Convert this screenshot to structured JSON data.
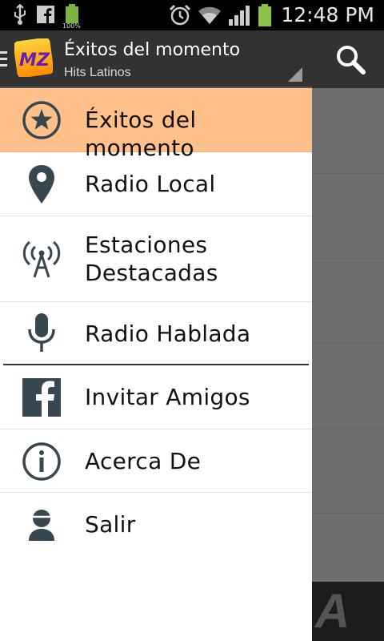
{
  "status_bar": {
    "time": "12:48 PM",
    "battery_small_label": "100%",
    "icons": [
      "usb-icon",
      "facebook-notification-icon",
      "battery-small-icon",
      "alarm-icon",
      "wifi-icon",
      "signal-icon",
      "battery-icon"
    ]
  },
  "action_bar": {
    "title": "Éxitos del momento",
    "subtitle": "Hits Latinos",
    "logo_text": "MZ",
    "search_icon": "search-icon"
  },
  "drawer": {
    "items": [
      {
        "label": "Éxitos del momento",
        "icon": "star-icon",
        "selected": true
      },
      {
        "label": "Radio Local",
        "icon": "location-pin-icon"
      },
      {
        "label": "Estaciones\nDestacadas",
        "icon": "antenna-icon"
      },
      {
        "label": "Radio Hablada",
        "icon": "microphone-icon"
      },
      {
        "label": "Invitar Amigos",
        "icon": "facebook-icon"
      },
      {
        "label": "Acerca De",
        "icon": "info-icon"
      },
      {
        "label": "Salir",
        "icon": "user-icon"
      }
    ]
  },
  "background_peek": {
    "text": "A"
  },
  "colors": {
    "selected_item_bg": "#ffc08a",
    "action_bar_bg": "#323232",
    "icon_color": "#37474f"
  }
}
